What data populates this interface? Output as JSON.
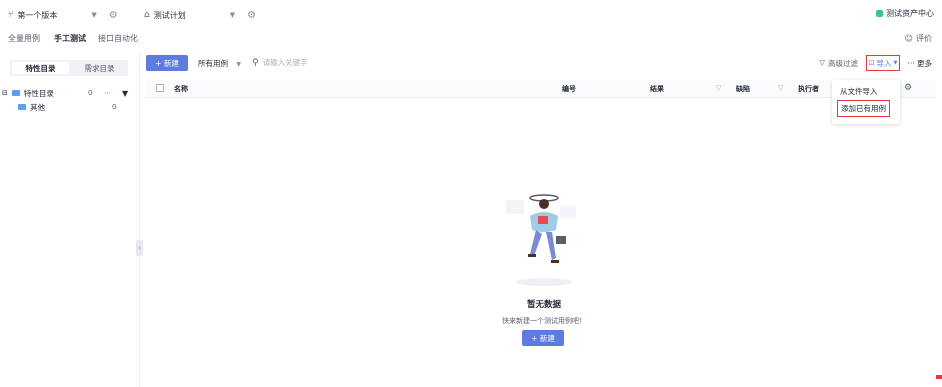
{
  "topbar": {
    "version_label": "第一个版本",
    "plan_label": "测试计划",
    "brand_label": "测试资产中心"
  },
  "tabs": {
    "items": [
      "全量用例",
      "手工测试",
      "接口自动化"
    ],
    "active": "手工测试",
    "eval_label": "评价"
  },
  "sidebar": {
    "segments": [
      "特性目录",
      "需求目录"
    ],
    "active_segment": "特性目录",
    "tree": [
      {
        "label": "特性目录",
        "count": "0",
        "level": 0
      },
      {
        "label": "其他",
        "count": "0",
        "level": 1
      }
    ]
  },
  "toolbar": {
    "new_label": "+ 新建",
    "filter_label": "所有用例",
    "search_placeholder": "请输入关键字",
    "advanced_filter": "高级过滤",
    "import_label": "导入",
    "more_label": "··· 更多"
  },
  "table": {
    "columns": [
      "名称",
      "编号",
      "结果",
      "缺陷",
      "执行者"
    ]
  },
  "import_menu": {
    "items": [
      "从文件导入",
      "添加已有用例"
    ],
    "highlighted": "添加已有用例"
  },
  "empty": {
    "title": "暂无数据",
    "subtitle": "快来新建一个测试用例吧！",
    "button": "+ 新建"
  },
  "colors": {
    "primary": "#5e7ce0",
    "highlight_border": "#e33a3a",
    "folder": "#5e9bf5"
  }
}
